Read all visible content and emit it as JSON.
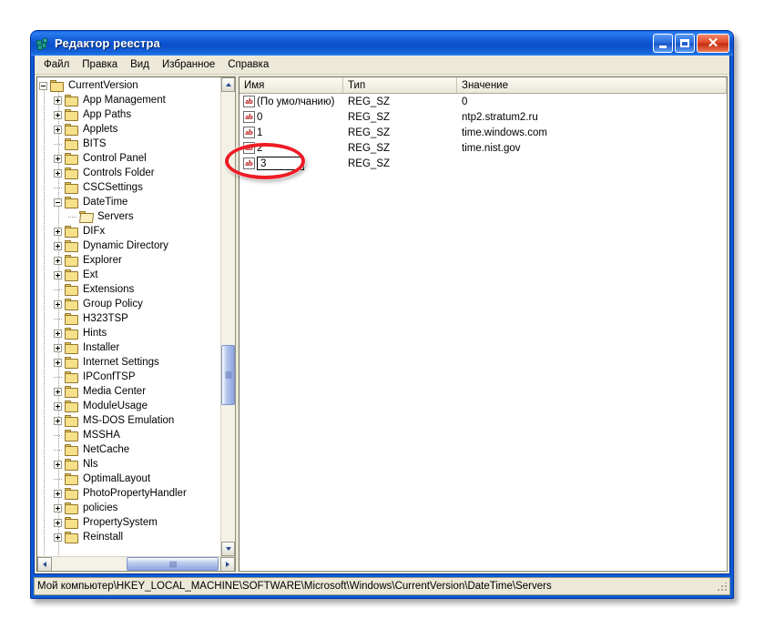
{
  "window": {
    "title": "Редактор реестра",
    "icon": "registry-editor-icon",
    "buttons": {
      "minimize": "_",
      "maximize": "□",
      "close": "✕"
    }
  },
  "menubar": {
    "items": [
      {
        "label": "Файл"
      },
      {
        "label": "Правка"
      },
      {
        "label": "Вид"
      },
      {
        "label": "Избранное"
      },
      {
        "label": "Справка"
      }
    ]
  },
  "tree": {
    "nodes": [
      {
        "label": "CurrentVersion",
        "depth": 0,
        "expander": "minus",
        "icon": "folder-icon",
        "selected": false
      },
      {
        "label": "App Management",
        "depth": 1,
        "expander": "plus",
        "icon": "folder-icon",
        "selected": false
      },
      {
        "label": "App Paths",
        "depth": 1,
        "expander": "plus",
        "icon": "folder-icon",
        "selected": false
      },
      {
        "label": "Applets",
        "depth": 1,
        "expander": "plus",
        "icon": "folder-icon",
        "selected": false
      },
      {
        "label": "BITS",
        "depth": 1,
        "expander": "none",
        "icon": "folder-icon",
        "selected": false
      },
      {
        "label": "Control Panel",
        "depth": 1,
        "expander": "plus",
        "icon": "folder-icon",
        "selected": false
      },
      {
        "label": "Controls Folder",
        "depth": 1,
        "expander": "plus",
        "icon": "folder-icon",
        "selected": false
      },
      {
        "label": "CSCSettings",
        "depth": 1,
        "expander": "none",
        "icon": "folder-icon",
        "selected": false
      },
      {
        "label": "DateTime",
        "depth": 1,
        "expander": "minus",
        "icon": "folder-icon",
        "selected": false
      },
      {
        "label": "Servers",
        "depth": 2,
        "expander": "none",
        "icon": "folder-open-icon",
        "selected": false
      },
      {
        "label": "DIFx",
        "depth": 1,
        "expander": "plus",
        "icon": "folder-icon",
        "selected": false
      },
      {
        "label": "Dynamic Directory",
        "depth": 1,
        "expander": "plus",
        "icon": "folder-icon",
        "selected": false
      },
      {
        "label": "Explorer",
        "depth": 1,
        "expander": "plus",
        "icon": "folder-icon",
        "selected": false
      },
      {
        "label": "Ext",
        "depth": 1,
        "expander": "plus",
        "icon": "folder-icon",
        "selected": false
      },
      {
        "label": "Extensions",
        "depth": 1,
        "expander": "none",
        "icon": "folder-icon",
        "selected": false
      },
      {
        "label": "Group Policy",
        "depth": 1,
        "expander": "plus",
        "icon": "folder-icon",
        "selected": false
      },
      {
        "label": "H323TSP",
        "depth": 1,
        "expander": "none",
        "icon": "folder-icon",
        "selected": false
      },
      {
        "label": "Hints",
        "depth": 1,
        "expander": "plus",
        "icon": "folder-icon",
        "selected": false
      },
      {
        "label": "Installer",
        "depth": 1,
        "expander": "plus",
        "icon": "folder-icon",
        "selected": false
      },
      {
        "label": "Internet Settings",
        "depth": 1,
        "expander": "plus",
        "icon": "folder-icon",
        "selected": false
      },
      {
        "label": "IPConfTSP",
        "depth": 1,
        "expander": "none",
        "icon": "folder-icon",
        "selected": false
      },
      {
        "label": "Media Center",
        "depth": 1,
        "expander": "plus",
        "icon": "folder-icon",
        "selected": false
      },
      {
        "label": "ModuleUsage",
        "depth": 1,
        "expander": "plus",
        "icon": "folder-icon",
        "selected": false
      },
      {
        "label": "MS-DOS Emulation",
        "depth": 1,
        "expander": "plus",
        "icon": "folder-icon",
        "selected": false
      },
      {
        "label": "MSSHA",
        "depth": 1,
        "expander": "none",
        "icon": "folder-icon",
        "selected": false
      },
      {
        "label": "NetCache",
        "depth": 1,
        "expander": "none",
        "icon": "folder-icon",
        "selected": false
      },
      {
        "label": "Nls",
        "depth": 1,
        "expander": "plus",
        "icon": "folder-icon",
        "selected": false
      },
      {
        "label": "OptimalLayout",
        "depth": 1,
        "expander": "none",
        "icon": "folder-icon",
        "selected": false
      },
      {
        "label": "PhotoPropertyHandler",
        "depth": 1,
        "expander": "plus",
        "icon": "folder-icon",
        "selected": false
      },
      {
        "label": "policies",
        "depth": 1,
        "expander": "plus",
        "icon": "folder-icon",
        "selected": false
      },
      {
        "label": "PropertySystem",
        "depth": 1,
        "expander": "plus",
        "icon": "folder-icon",
        "selected": false
      },
      {
        "label": "Reinstall",
        "depth": 1,
        "expander": "plus",
        "icon": "folder-icon",
        "selected": false
      }
    ]
  },
  "list": {
    "columns": [
      {
        "label": "Имя"
      },
      {
        "label": "Тип"
      },
      {
        "label": "Значение"
      }
    ],
    "rows": [
      {
        "name": "(По умолчанию)",
        "type": "REG_SZ",
        "value": "0",
        "editing": false
      },
      {
        "name": "0",
        "type": "REG_SZ",
        "value": "ntp2.stratum2.ru",
        "editing": false
      },
      {
        "name": "1",
        "type": "REG_SZ",
        "value": "time.windows.com",
        "editing": false
      },
      {
        "name": "2",
        "type": "REG_SZ",
        "value": "time.nist.gov",
        "editing": false
      },
      {
        "name": "3",
        "type": "REG_SZ",
        "value": "",
        "editing": true
      }
    ]
  },
  "statusbar": {
    "path": "Мой компьютер\\HKEY_LOCAL_MACHINE\\SOFTWARE\\Microsoft\\Windows\\CurrentVersion\\DateTime\\Servers"
  },
  "annotation": {
    "shape": "ellipse",
    "color": "#ee1c25",
    "target": "new-value-name-edit"
  }
}
